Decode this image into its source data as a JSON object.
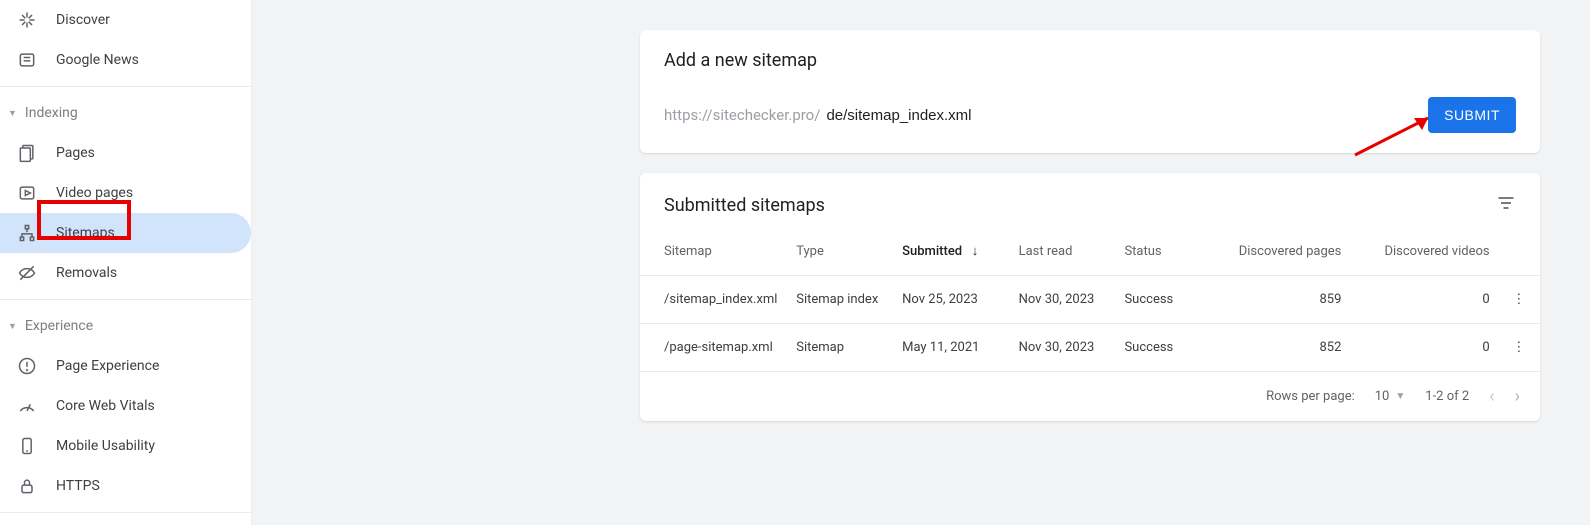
{
  "sidebar": {
    "items_top": [
      {
        "label": "Discover",
        "icon": "discover"
      },
      {
        "label": "Google News",
        "icon": "news"
      }
    ],
    "group_indexing": {
      "label": "Indexing"
    },
    "items_indexing": [
      {
        "label": "Pages",
        "icon": "pages"
      },
      {
        "label": "Video pages",
        "icon": "video"
      },
      {
        "label": "Sitemaps",
        "icon": "sitemap",
        "active": true
      },
      {
        "label": "Removals",
        "icon": "removals"
      }
    ],
    "group_experience": {
      "label": "Experience"
    },
    "items_experience": [
      {
        "label": "Page Experience",
        "icon": "pageexp"
      },
      {
        "label": "Core Web Vitals",
        "icon": "cwv"
      },
      {
        "label": "Mobile Usability",
        "icon": "mobile"
      },
      {
        "label": "HTTPS",
        "icon": "https"
      }
    ]
  },
  "add_card": {
    "title": "Add a new sitemap",
    "url_prefix": "https://sitechecker.pro/",
    "input_value": "de/sitemap_index.xml",
    "submit_label": "Submit"
  },
  "table_card": {
    "title": "Submitted sitemaps",
    "columns": {
      "sitemap": "Sitemap",
      "type": "Type",
      "submitted": "Submitted",
      "last_read": "Last read",
      "status": "Status",
      "disc_pages": "Discovered pages",
      "disc_videos": "Discovered videos"
    },
    "rows": [
      {
        "sitemap": "/sitemap_index.xml",
        "type": "Sitemap index",
        "submitted": "Nov 25, 2023",
        "last_read": "Nov 30, 2023",
        "status": "Success",
        "pages": "859",
        "videos": "0"
      },
      {
        "sitemap": "/page-sitemap.xml",
        "type": "Sitemap",
        "submitted": "May 11, 2021",
        "last_read": "Nov 30, 2023",
        "status": "Success",
        "pages": "852",
        "videos": "0"
      }
    ],
    "footer": {
      "rows_label": "Rows per page:",
      "rows_value": "10",
      "range": "1-2 of 2"
    }
  }
}
